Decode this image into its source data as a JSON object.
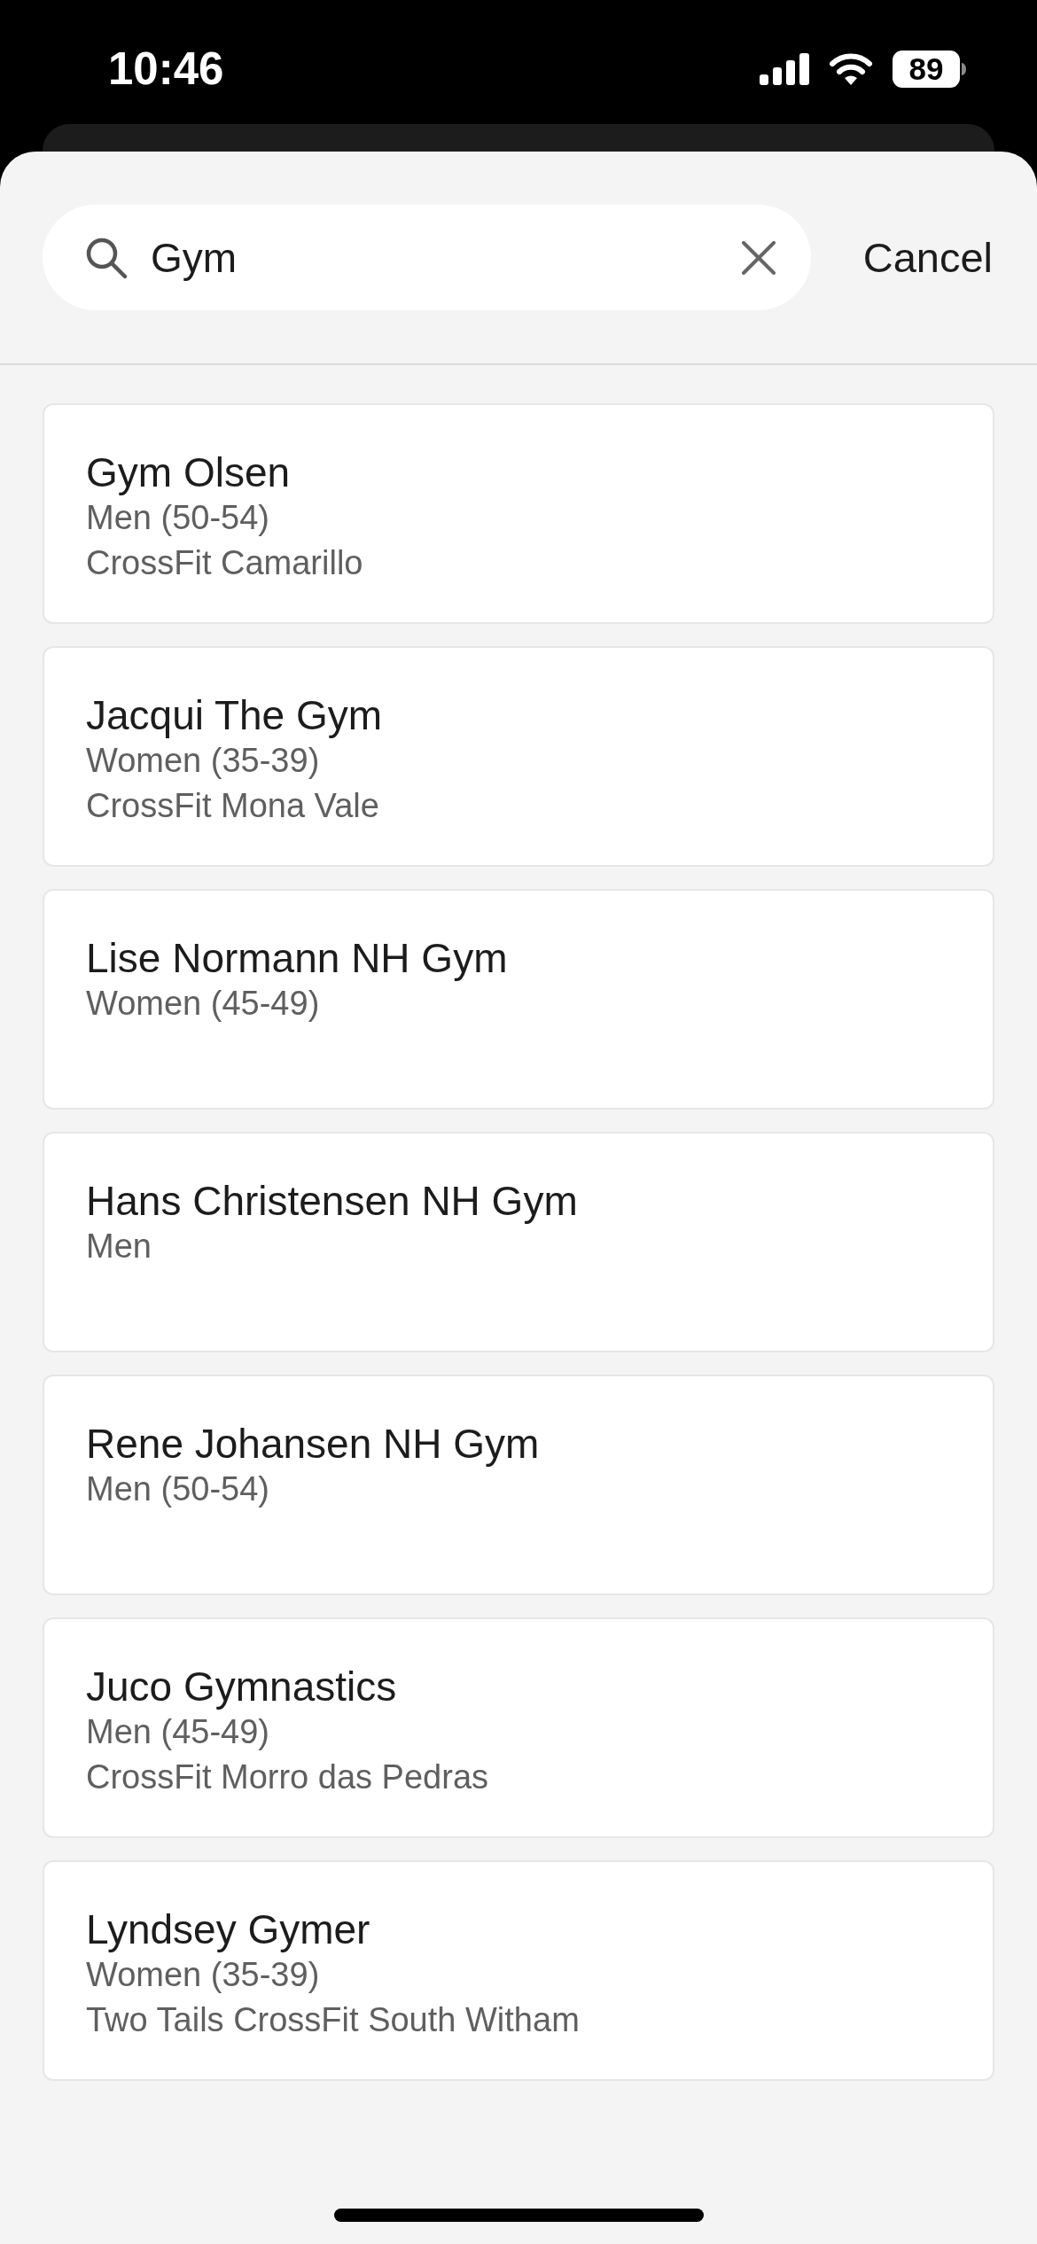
{
  "status_bar": {
    "time": "10:46",
    "battery": "89"
  },
  "search": {
    "value": "Gym"
  },
  "cancel": "Cancel",
  "results": [
    {
      "name": "Gym Olsen",
      "division": "Men (50-54)",
      "affiliate": "CrossFit Camarillo"
    },
    {
      "name": "Jacqui The Gym",
      "division": "Women (35-39)",
      "affiliate": "CrossFit Mona Vale"
    },
    {
      "name": "Lise Normann NH Gym",
      "division": "Women (45-49)"
    },
    {
      "name": "Hans Christensen NH Gym",
      "division": "Men"
    },
    {
      "name": "Rene Johansen NH Gym",
      "division": "Men (50-54)"
    },
    {
      "name": "Juco Gymnastics",
      "division": "Men (45-49)",
      "affiliate": "CrossFit Morro das Pedras"
    },
    {
      "name": "Lyndsey Gymer",
      "division": "Women (35-39)",
      "affiliate": "Two Tails CrossFit South Witham"
    }
  ]
}
